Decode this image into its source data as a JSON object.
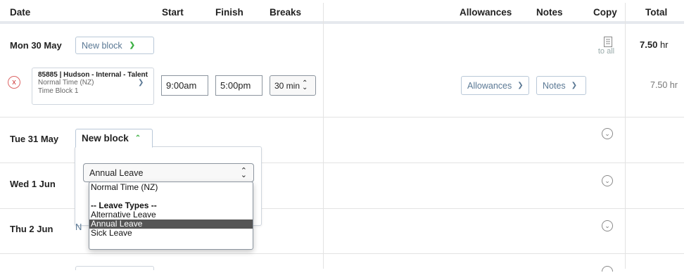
{
  "header": {
    "date": "Date",
    "start": "Start",
    "finish": "Finish",
    "breaks": "Breaks",
    "allowances": "Allowances",
    "notes": "Notes",
    "copy": "Copy",
    "total": "Total"
  },
  "days": [
    {
      "label": "Mon 30 May",
      "new_block": "New block",
      "copy_to_all": "to all",
      "total_value": "7.50",
      "total_unit": "hr",
      "block": {
        "remove": "x",
        "title": "85885 | Hudson - Internal - Talent",
        "subtitle1": "Normal Time (NZ)",
        "subtitle2": "Time Block 1",
        "start": "9:00am",
        "finish": "5:00pm",
        "breaks": "30 min",
        "allowances": "Allowances",
        "notes": "Notes",
        "total": "7.50 hr"
      }
    },
    {
      "label": "Tue 31 May",
      "new_block": "New block"
    },
    {
      "label": "Wed 1 Jun"
    },
    {
      "label": "Thu 2 Jun",
      "partial_button": "N"
    }
  ],
  "leave_popup": {
    "selected": "Annual Leave",
    "options": [
      {
        "label": "Normal Time (NZ)",
        "type": "option"
      },
      {
        "label": "",
        "type": "spacer"
      },
      {
        "label": "-- Leave Types --",
        "type": "group"
      },
      {
        "label": "Alternative Leave",
        "type": "option"
      },
      {
        "label": "Annual Leave",
        "type": "selected"
      },
      {
        "label": "Sick Leave",
        "type": "option"
      }
    ]
  },
  "colors": {
    "accent_green": "#3cb043",
    "link_blue": "#5a7894",
    "remove_red": "#cc3333",
    "selected_bg": "#555555"
  },
  "icons": {
    "copy": "copy-document-icon",
    "chevron": "chevron-down-icon",
    "chevron_up": "chevron-up-icon",
    "remove": "remove-x-icon",
    "updown": "updown-arrows-icon"
  }
}
